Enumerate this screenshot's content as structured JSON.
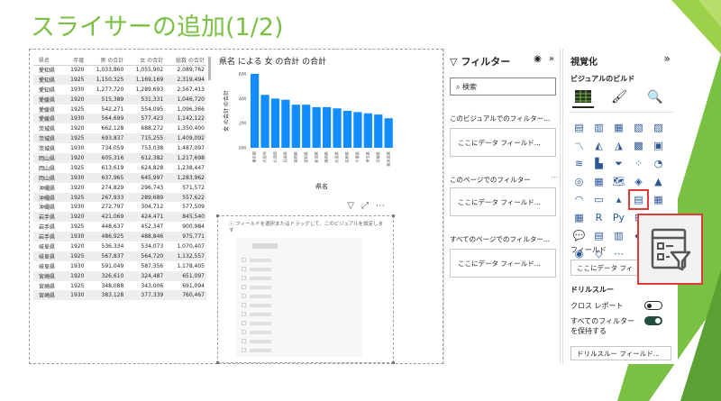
{
  "slide": {
    "title": "スライサーの追加(1/2)"
  },
  "table": {
    "headers": [
      "県名",
      "年度",
      "男 の合計",
      "女 の合計",
      "総数 の合計"
    ],
    "rows": [
      [
        "愛知県",
        "1920",
        "1,033,860",
        "1,055,902",
        "2,089,762"
      ],
      [
        "愛知県",
        "1925",
        "1,150,325",
        "1,169,169",
        "2,319,494"
      ],
      [
        "愛知県",
        "1930",
        "1,277,720",
        "1,289,693",
        "2,567,413"
      ],
      [
        "愛媛県",
        "1920",
        "515,389",
        "531,331",
        "1,046,720"
      ],
      [
        "愛媛県",
        "1925",
        "542,271",
        "554,095",
        "1,096,366"
      ],
      [
        "愛媛県",
        "1930",
        "564,699",
        "577,423",
        "1,142,122"
      ],
      [
        "茨城県",
        "1920",
        "662,128",
        "688,272",
        "1,350,400"
      ],
      [
        "茨城県",
        "1925",
        "693,837",
        "715,255",
        "1,409,092"
      ],
      [
        "茨城県",
        "1930",
        "734,059",
        "753,038",
        "1,487,097"
      ],
      [
        "岡山県",
        "1920",
        "605,316",
        "612,382",
        "1,217,698"
      ],
      [
        "岡山県",
        "1925",
        "613,619",
        "624,828",
        "1,238,447"
      ],
      [
        "岡山県",
        "1930",
        "637,965",
        "645,997",
        "1,283,962"
      ],
      [
        "沖縄県",
        "1920",
        "274,829",
        "296,743",
        "571,572"
      ],
      [
        "沖縄県",
        "1925",
        "267,933",
        "289,689",
        "557,622"
      ],
      [
        "沖縄県",
        "1930",
        "272,797",
        "304,712",
        "577,509"
      ],
      [
        "岩手県",
        "1920",
        "421,069",
        "424,471",
        "845,540"
      ],
      [
        "岩手県",
        "1925",
        "448,637",
        "452,347",
        "900,984"
      ],
      [
        "岩手県",
        "1930",
        "486,925",
        "488,846",
        "975,771"
      ],
      [
        "岐阜県",
        "1920",
        "536,334",
        "534,073",
        "1,070,407"
      ],
      [
        "岐阜県",
        "1925",
        "567,837",
        "564,720",
        "1,132,557"
      ],
      [
        "岐阜県",
        "1930",
        "591,049",
        "587,356",
        "1,178,405"
      ],
      [
        "宮崎県",
        "1920",
        "326,610",
        "324,487",
        "651,097"
      ],
      [
        "宮崎県",
        "1925",
        "348,088",
        "343,006",
        "691,094"
      ],
      [
        "宮崎県",
        "1930",
        "383,128",
        "377,339",
        "760,467"
      ]
    ]
  },
  "chart_data": {
    "type": "bar",
    "title": "県名 による 女 の合計 の合計",
    "xlabel": "県名",
    "ylabel": "女 の合計 の合計",
    "ylim": [
      0,
      6
    ],
    "yticks": [
      "0M",
      "2M",
      "4M",
      "6M"
    ],
    "categories": [
      "東京都",
      "大阪府",
      "北海道",
      "兵庫県",
      "福岡県",
      "愛知県",
      "新潟県",
      "静岡県",
      "広島県",
      "長野県",
      "千葉県",
      "埼玉県",
      "茨城県",
      "鹿児島県"
    ],
    "values": [
      6.9,
      4.3,
      4.0,
      3.9,
      3.5,
      3.5,
      3.3,
      3.3,
      3.2,
      3.0,
      2.9,
      2.8,
      2.7,
      2.4
    ],
    "color": "#118dff"
  },
  "empty_visual": {
    "hint": "フィールドを選択またはドラッグして、このビジュアルを設定しま す"
  },
  "filter_pane": {
    "title": "フィルター",
    "search_placeholder": "検索",
    "sections": [
      {
        "label": "このビジュアルでのフィルター...",
        "drop": "ここにデータ フィールド..."
      },
      {
        "label": "このページでのフィルター",
        "drop": "ここにデータ フィールド..."
      },
      {
        "label": "すべてのページでのフィルター...",
        "drop": "ここにデータ フィールド..."
      }
    ]
  },
  "viz_pane": {
    "title": "視覚化",
    "build_label": "ビジュアルのビルド",
    "fields_label": "フィールド",
    "fields_drop": "ここにデータ フィ",
    "drillthrough_label": "ドリルスルー",
    "cross_report_label": "クロス レポート",
    "keep_filters_label": "すべてのフィルター を保持する",
    "drillthrough_drop": "ドリルスルー フィールド...",
    "cross_report_on": false,
    "keep_filters_on": true
  },
  "colors": {
    "accent_green": "#7ac143",
    "bar_blue": "#118dff",
    "highlight_red": "#e03a3a"
  }
}
